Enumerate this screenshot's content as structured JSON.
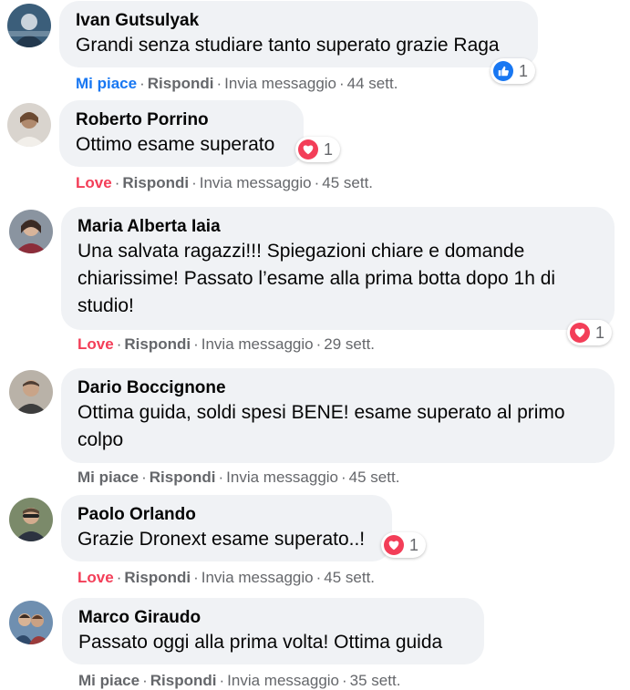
{
  "actions": {
    "like": "Mi piace",
    "love": "Love",
    "reply": "Rispondi",
    "message": "Invia messaggio",
    "separator": "·"
  },
  "comments": [
    {
      "author": "Ivan Gutsulyak",
      "text": "Grandi senza studiare tanto superato grazie Raga",
      "reaction_label": "Mi piace",
      "time": "44 sett.",
      "reaction": {
        "type": "like-icon",
        "count": "1"
      }
    },
    {
      "author": "Roberto Porrino",
      "text": "Ottimo esame superato",
      "reaction_label": "Love",
      "time": "45 sett.",
      "reaction": {
        "type": "heart-icon",
        "count": "1"
      }
    },
    {
      "author": "Maria Alberta Iaia",
      "text": "Una salvata ragazzi!!! Spiegazioni chiare e domande chiarissime! Passato l’esame alla prima botta dopo 1h di studio!",
      "reaction_label": "Love",
      "time": "29 sett.",
      "reaction": {
        "type": "heart-icon",
        "count": "1"
      }
    },
    {
      "author": "Dario Boccignone",
      "text": "Ottima guida, soldi spesi BENE! esame superato al primo colpo",
      "reaction_label": "Mi piace",
      "time": "45 sett."
    },
    {
      "author": "Paolo Orlando",
      "text": "Grazie Dronext esame superato..!",
      "reaction_label": "Love",
      "time": "45 sett.",
      "reaction": {
        "type": "heart-icon",
        "count": "1"
      }
    },
    {
      "author": "Marco Giraudo",
      "text": "Passato oggi alla prima volta! Ottima guida",
      "reaction_label": "Mi piace",
      "time": "35 sett."
    }
  ],
  "colors": {
    "bubble": "#f0f2f5",
    "like_blue": "#1877f2",
    "love_red": "#f33e58",
    "meta_grey": "#65676b"
  }
}
